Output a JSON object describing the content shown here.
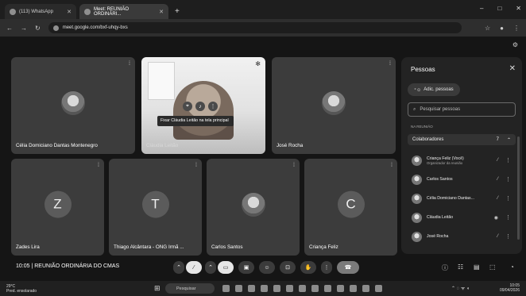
{
  "browser": {
    "tabs": [
      {
        "title": "(113) WhatsApp"
      },
      {
        "title": "Meet: REUNIÃO ORDINÁRI..."
      }
    ],
    "new_tab": "+",
    "window_controls": [
      "–",
      "□",
      "✕"
    ],
    "url": "meet.google.com/bxf-uhqy-bxs"
  },
  "tiles": [
    {
      "name": "Célia Domiciano Dantas Montenegro",
      "avatar": "photo"
    },
    {
      "name": "Cláudia Leitão",
      "avatar": "video"
    },
    {
      "name": "José Rocha",
      "avatar": "photo"
    },
    {
      "name": "Zades Lira",
      "letter": "Z"
    },
    {
      "name": "Thiago Alcântara - ONG Irmã ...",
      "letter": "T"
    },
    {
      "name": "Carlos Santos",
      "avatar": "photo"
    },
    {
      "name": "Criança Feliz",
      "letter": "C"
    }
  ],
  "video_tooltip": "Fixar Cláudia Leitão na tela principal",
  "panel": {
    "title": "Pessoas",
    "add_people": "Adic. pessoas",
    "search_placeholder": "Pesquisar pessoas",
    "section_label": "NA REUNIÃO",
    "group_label": "Colaboradores",
    "group_count": "7",
    "people": [
      {
        "name": "Criança Feliz (Você)",
        "sub": "Organizador da reunião"
      },
      {
        "name": "Carlos Santos",
        "sub": ""
      },
      {
        "name": "Célia Domiciano Dantas...",
        "sub": ""
      },
      {
        "name": "Cláudia Leitão",
        "sub": ""
      },
      {
        "name": "José Rocha",
        "sub": ""
      }
    ]
  },
  "meeting": {
    "time": "10:05",
    "title": "REUNIÃO ORDINÁRIA DO CMAS"
  },
  "taskbar": {
    "weather_temp": "29°C",
    "weather_desc": "Pred. ensolarado",
    "search_placeholder": "Pesquisar",
    "clock_time": "10:05",
    "clock_date": "09/04/2026"
  }
}
